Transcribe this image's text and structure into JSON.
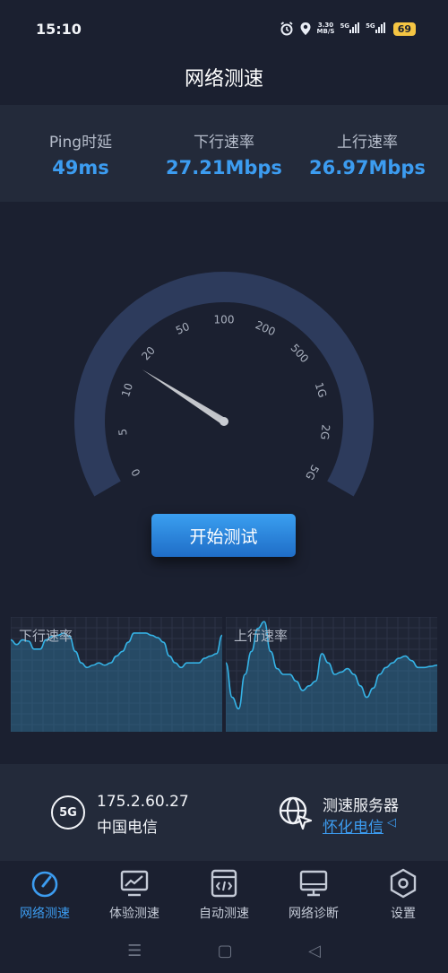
{
  "status_bar": {
    "time": "15:10",
    "net_speed_value": "3.30",
    "net_speed_unit": "MB/S",
    "signal1": "5G",
    "signal2": "5G",
    "battery": "69"
  },
  "page_title": "网络测速",
  "stats": [
    {
      "label": "Ping时延",
      "value": "49ms"
    },
    {
      "label": "下行速率",
      "value": "27.21Mbps"
    },
    {
      "label": "上行速率",
      "value": "26.97Mbps"
    }
  ],
  "gauge": {
    "ticks": [
      "0",
      "5",
      "10",
      "20",
      "50",
      "100",
      "200",
      "500",
      "1G",
      "2G",
      "5G"
    ],
    "needle_fraction": 0.26
  },
  "start_button": "开始测试",
  "charts": [
    {
      "label": "下行速率",
      "curve": [
        0.8,
        0.76,
        0.8,
        0.79,
        0.72,
        0.72,
        0.8,
        0.83,
        0.84,
        0.86,
        0.83,
        0.7,
        0.6,
        0.56,
        0.58,
        0.6,
        0.58,
        0.6,
        0.66,
        0.7,
        0.78,
        0.86,
        0.86,
        0.86,
        0.84,
        0.82,
        0.78,
        0.66,
        0.6,
        0.56,
        0.6,
        0.6,
        0.6,
        0.64,
        0.66,
        0.68,
        0.84
      ]
    },
    {
      "label": "上行速率",
      "curve": [
        0.6,
        0.3,
        0.2,
        0.5,
        0.7,
        0.9,
        0.96,
        0.7,
        0.55,
        0.5,
        0.5,
        0.44,
        0.36,
        0.4,
        0.44,
        0.68,
        0.6,
        0.5,
        0.52,
        0.55,
        0.5,
        0.4,
        0.3,
        0.38,
        0.5,
        0.56,
        0.6,
        0.64,
        0.66,
        0.62,
        0.56,
        0.56,
        0.57,
        0.58
      ]
    }
  ],
  "network_info": {
    "badge": "5G",
    "ip": "175.2.60.27",
    "carrier": "中国电信",
    "server_title": "测速服务器",
    "server_name": "怀化电信",
    "server_arrow": "◁"
  },
  "nav": [
    {
      "label": "网络测速",
      "icon": "speedometer-icon",
      "active": true
    },
    {
      "label": "体验测速",
      "icon": "chart-monitor-icon",
      "active": false
    },
    {
      "label": "自动测速",
      "icon": "code-window-icon",
      "active": false
    },
    {
      "label": "网络诊断",
      "icon": "desktop-icon",
      "active": false
    },
    {
      "label": "设置",
      "icon": "settings-hexagon-icon",
      "active": false
    }
  ],
  "system_nav": {
    "menu": "☰",
    "home": "▢",
    "back": "◁"
  },
  "colors": {
    "background": "#1b2030",
    "panel": "#232a3a",
    "accent": "#3c9cf0",
    "gauge_arc": "#2d3b5c"
  }
}
